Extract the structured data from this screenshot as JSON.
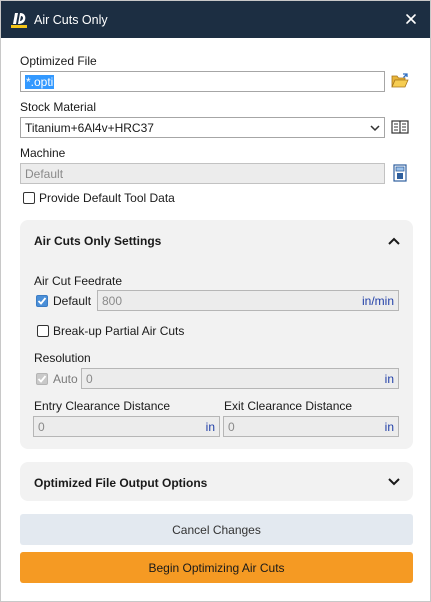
{
  "window": {
    "title": "Air Cuts Only"
  },
  "optimized_file": {
    "label": "Optimized File",
    "value": "*.opti"
  },
  "stock_material": {
    "label": "Stock Material",
    "value": "Titanium+6Al4v+HRC37"
  },
  "machine": {
    "label": "Machine",
    "value": "Default"
  },
  "provide_default_tool_data": {
    "label": "Provide Default Tool Data",
    "checked": false
  },
  "settings_panel": {
    "title": "Air Cuts Only Settings",
    "air_cut_feedrate": {
      "label": "Air Cut Feedrate",
      "default_label": "Default",
      "default_checked": true,
      "value": "800",
      "unit": "in/min"
    },
    "break_up": {
      "label": "Break-up Partial Air Cuts",
      "checked": false
    },
    "resolution": {
      "label": "Resolution",
      "auto_label": "Auto",
      "auto_checked": true,
      "value": "0",
      "unit": "in"
    },
    "entry_clearance": {
      "label": "Entry Clearance Distance",
      "value": "0",
      "unit": "in"
    },
    "exit_clearance": {
      "label": "Exit Clearance Distance",
      "value": "0",
      "unit": "in"
    }
  },
  "output_panel": {
    "title": "Optimized File Output Options"
  },
  "buttons": {
    "cancel": "Cancel Changes",
    "begin": "Begin Optimizing Air Cuts"
  },
  "colors": {
    "titlebar": "#1c2e42",
    "accent": "#f59a23",
    "unit_text": "#2140a8",
    "checkbox": "#4a8fd8"
  },
  "icons": [
    "app-logo-icon",
    "close-icon",
    "folder-open-icon",
    "material-library-icon",
    "machine-settings-icon",
    "chevron-up-icon",
    "chevron-down-icon",
    "checkmark-icon"
  ]
}
